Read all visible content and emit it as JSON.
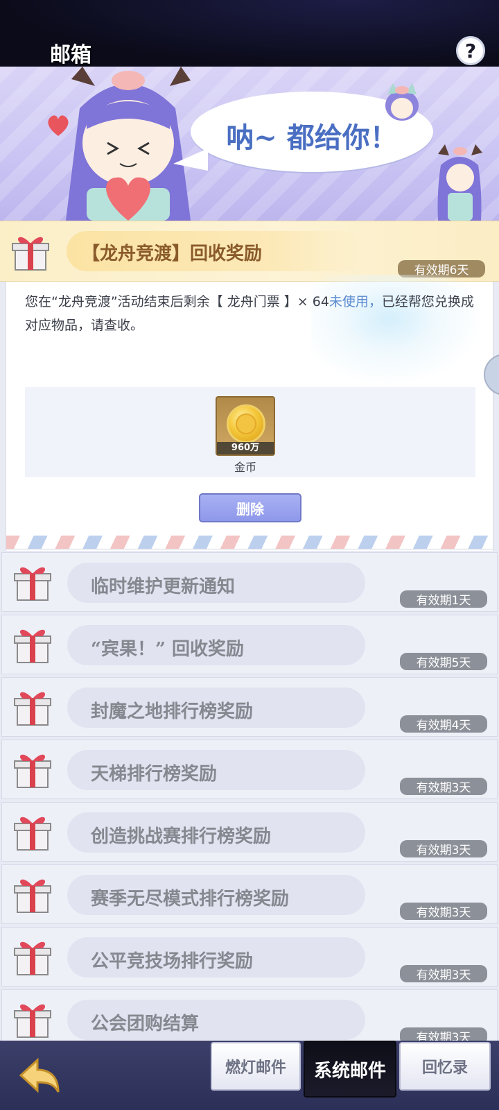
{
  "header": {
    "title": "邮箱",
    "help_label": "?"
  },
  "banner": {
    "speech": "呐~ 都给你！"
  },
  "selected_mail": {
    "title": "【龙舟竞渡】回收奖励",
    "expiry": "有效期6天",
    "body_part1": "您在“龙舟竞渡”活动结束后剩余【 龙舟门票 】× 64",
    "body_highlight": "未使用，",
    "body_part2": "已经帮您兑换成对应物品，请查收。",
    "reward": {
      "icon": "gold-coin-icon",
      "quantity": "960万",
      "name": "金币"
    },
    "delete_label": "删除"
  },
  "mail_list": [
    {
      "title": "临时维护更新通知",
      "expiry": "有效期1天"
    },
    {
      "title": "“宾果！” 回收奖励",
      "expiry": "有效期5天"
    },
    {
      "title": "封魔之地排行榜奖励",
      "expiry": "有效期4天"
    },
    {
      "title": "天梯排行榜奖励",
      "expiry": "有效期3天"
    },
    {
      "title": "创造挑战赛排行榜奖励",
      "expiry": "有效期3天"
    },
    {
      "title": "赛季无尽模式排行榜奖励",
      "expiry": "有效期3天"
    },
    {
      "title": "公平竞技场排行奖励",
      "expiry": "有效期3天"
    },
    {
      "title": "公会团购结算",
      "expiry": "有效期3天"
    }
  ],
  "bottom_tabs": {
    "tab1": "燃灯邮件",
    "tab2": "系统邮件",
    "tab3": "回忆录"
  },
  "colors": {
    "accent_blue": "#5b8bd0",
    "selected_bg": "#fbefc8",
    "badge_gray": "#8c9098",
    "active_tab": "#0e0e18"
  }
}
